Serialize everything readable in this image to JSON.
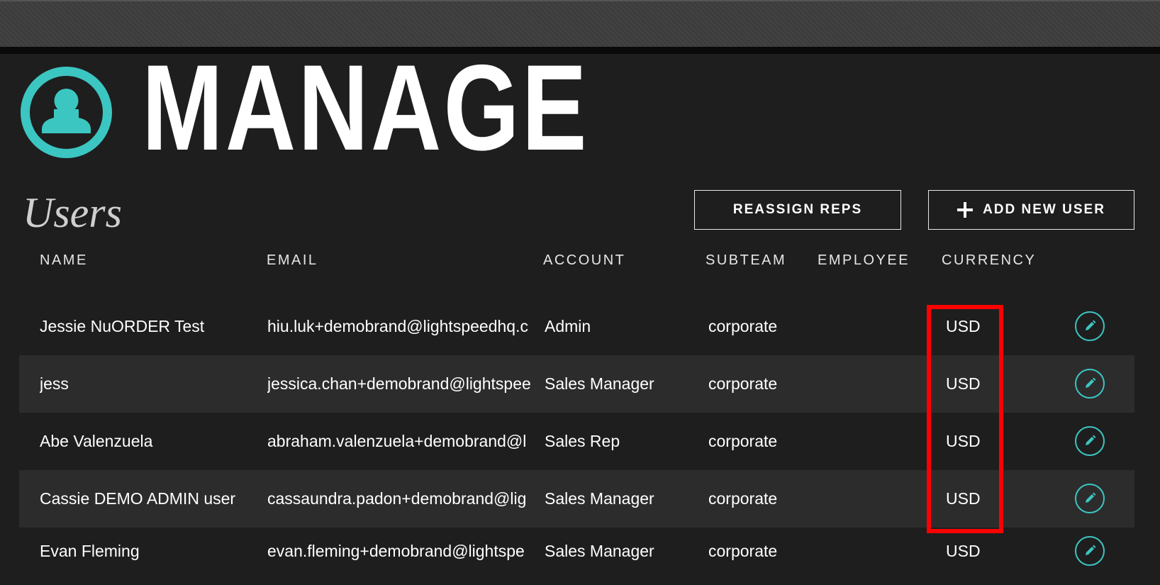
{
  "header": {
    "logo_text": "MANAGE",
    "logo_icon": "user-circle-icon",
    "accent_color": "#3cc6c2"
  },
  "section": {
    "title": "Users"
  },
  "actions": {
    "reassign_label": "REASSIGN REPS",
    "add_label": "ADD NEW USER",
    "add_icon": "plus-icon"
  },
  "table": {
    "columns": [
      "NAME",
      "EMAIL",
      "ACCOUNT",
      "SUBTEAM",
      "EMPLOYEE",
      "CURRENCY"
    ],
    "rows": [
      {
        "name": "Jessie NuORDER Test",
        "email": "hiu.luk+demobrand@lightspeedhq.c",
        "account": "Admin",
        "subteam": "corporate",
        "employee": "",
        "currency": "USD"
      },
      {
        "name": "jess",
        "email": "jessica.chan+demobrand@lightspee",
        "account": "Sales Manager",
        "subteam": "corporate",
        "employee": "",
        "currency": "USD"
      },
      {
        "name": "Abe Valenzuela",
        "email": "abraham.valenzuela+demobrand@l",
        "account": "Sales Rep",
        "subteam": "corporate",
        "employee": "",
        "currency": "USD"
      },
      {
        "name": "Cassie DEMO ADMIN user",
        "email": "cassaundra.padon+demobrand@lig",
        "account": "Sales Manager",
        "subteam": "corporate",
        "employee": "",
        "currency": "USD"
      },
      {
        "name": "Evan Fleming",
        "email": "evan.fleming+demobrand@lightspe",
        "account": "Sales Manager",
        "subteam": "corporate",
        "employee": "",
        "currency": "USD"
      }
    ],
    "row_action_icon": "pencil-edit-icon"
  },
  "annotation": {
    "highlight_color": "#ff0000",
    "target": "currency column"
  }
}
